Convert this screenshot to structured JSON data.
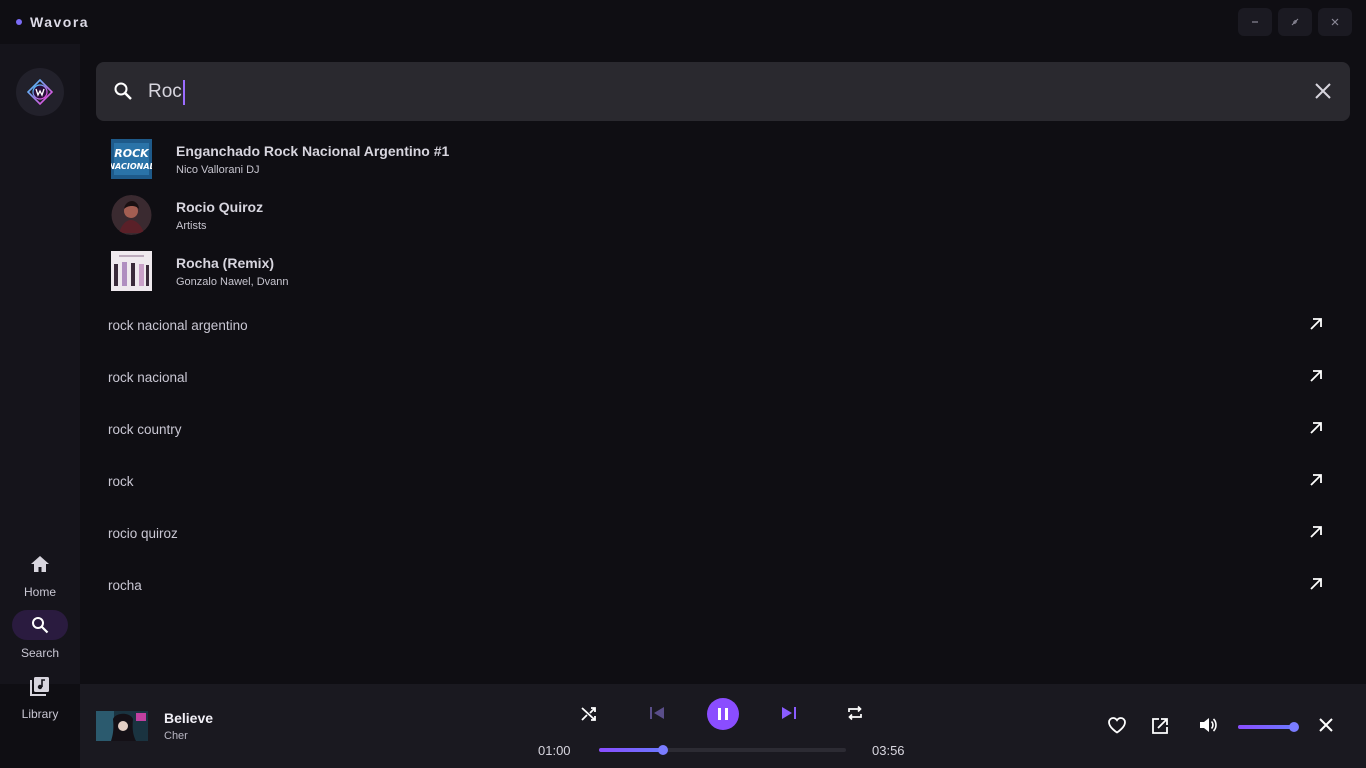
{
  "app": {
    "title": "Wavora"
  },
  "window": {
    "minimize_icon": "minimize-icon",
    "restore_icon": "restore-icon",
    "close_icon": "close-icon"
  },
  "sidebar": {
    "items": [
      {
        "label": "Home",
        "icon": "home-icon",
        "active": false
      },
      {
        "label": "Search",
        "icon": "search-icon",
        "active": true
      },
      {
        "label": "Library",
        "icon": "library-icon",
        "active": false
      }
    ]
  },
  "search": {
    "value": "Roc",
    "placeholder": ""
  },
  "results": [
    {
      "title": "Enganchado Rock Nacional Argentino #1",
      "subtitle": "Nico Vallorani DJ",
      "kind": "album"
    },
    {
      "title": "Rocio Quiroz",
      "subtitle": "Artists",
      "kind": "artist"
    },
    {
      "title": "Rocha (Remix)",
      "subtitle": "Gonzalo Nawel, Dvann",
      "kind": "song"
    }
  ],
  "suggestions": [
    "rock nacional argentino",
    "rock nacional",
    "rock country",
    "rock",
    "rocio quiroz",
    "rocha"
  ],
  "player": {
    "title": "Believe",
    "artist": "Cher",
    "current_time": "01:00",
    "duration": "03:56",
    "progress": 0.26,
    "volume": 0.96,
    "is_playing": true
  },
  "colors": {
    "accent": "#8a4dff",
    "accent2": "#6b78ff",
    "bg": "#0f0e13",
    "sidebar": "#15141b",
    "player": "#1a1920"
  }
}
